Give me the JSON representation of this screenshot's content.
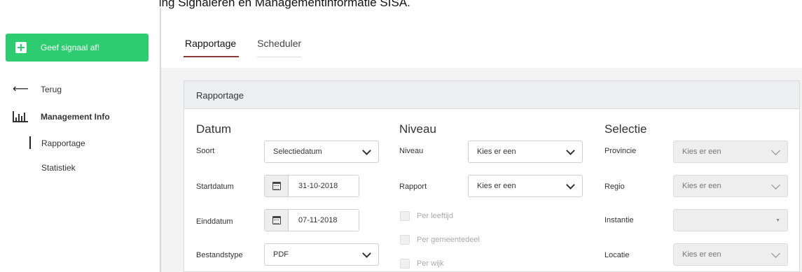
{
  "doc_title": "korte handleiding Signaleren en Managementinformatie SISA.",
  "sidebar": {
    "signal_button": "Geef signaal af!",
    "back": "Terug",
    "management": "Management Info",
    "sub_items": [
      "Rapportage",
      "Statistiek"
    ]
  },
  "tabs": [
    "Rapportage",
    "Scheduler"
  ],
  "panel": {
    "title": "Rapportage",
    "datum": {
      "title": "Datum",
      "soort_label": "Soort",
      "soort_value": "Selectiedatum",
      "start_label": "Startdatum",
      "start_value": "31-10-2018",
      "eind_label": "Einddatum",
      "eind_value": "07-11-2018",
      "bestand_label": "Bestandstype",
      "bestand_value": "PDF"
    },
    "niveau": {
      "title": "Niveau",
      "niveau_label": "Niveau",
      "niveau_value": "Kies er een",
      "rapport_label": "Rapport",
      "rapport_value": "Kies er een",
      "checkboxes": [
        "Per leeftijd",
        "Per gemeentedeel",
        "Per wijk"
      ]
    },
    "selectie": {
      "title": "Selectie",
      "provincie_label": "Provincie",
      "provincie_value": "Kies er een",
      "regio_label": "Regio",
      "regio_value": "Kies er een",
      "instantie_label": "Instantie",
      "instantie_value": "",
      "locatie_label": "Locatie",
      "locatie_value": "Kies er een"
    }
  },
  "colors": {
    "accent_green": "#2ecc71",
    "tab_underline": "#8b3a3a"
  }
}
